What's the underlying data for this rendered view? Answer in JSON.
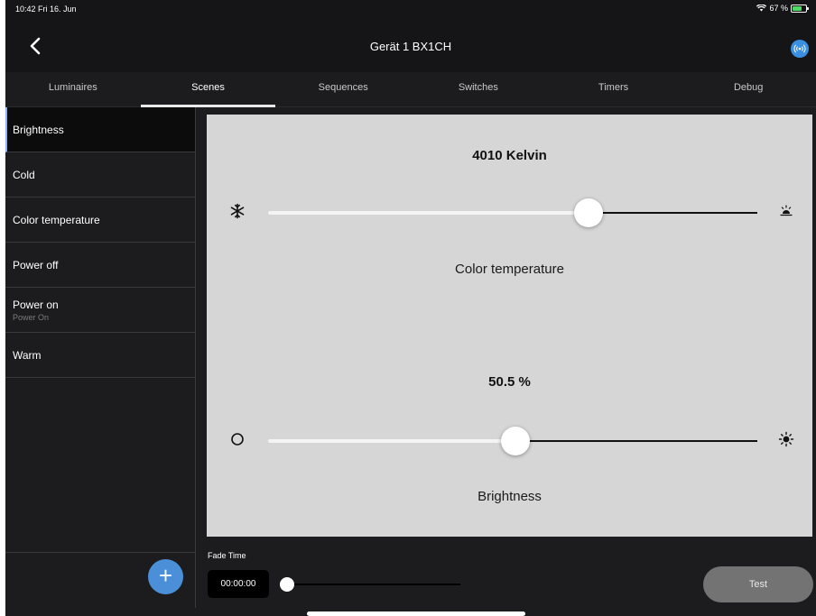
{
  "status_bar": {
    "time": "10:42  Fri 16. Jun",
    "battery": "67 %"
  },
  "nav": {
    "title": "Gerät 1 BX1CH"
  },
  "tabs": [
    {
      "label": "Luminaires",
      "active": false
    },
    {
      "label": "Scenes",
      "active": true
    },
    {
      "label": "Sequences",
      "active": false
    },
    {
      "label": "Switches",
      "active": false
    },
    {
      "label": "Timers",
      "active": false
    },
    {
      "label": "Debug",
      "active": false
    }
  ],
  "scenes": [
    {
      "label": "Brightness",
      "sub": "",
      "active": true
    },
    {
      "label": "Cold",
      "sub": ""
    },
    {
      "label": "Color temperature",
      "sub": ""
    },
    {
      "label": "Power off",
      "sub": ""
    },
    {
      "label": "Power on",
      "sub": "Power On"
    },
    {
      "label": "Warm",
      "sub": ""
    }
  ],
  "color_temperature": {
    "value_text": "4010 Kelvin",
    "label": "Color temperature",
    "position": 0.655
  },
  "brightness": {
    "value_text": "50.5 %",
    "label": "Brightness",
    "position": 0.505
  },
  "fade": {
    "label": "Fade Time",
    "time": "00:00:00",
    "position": 0.0
  },
  "buttons": {
    "add": "+",
    "test": "Test"
  },
  "colors": {
    "accent": "#4a8fd8",
    "panel": "#d6d6d6",
    "background": "#1c1c1e"
  }
}
